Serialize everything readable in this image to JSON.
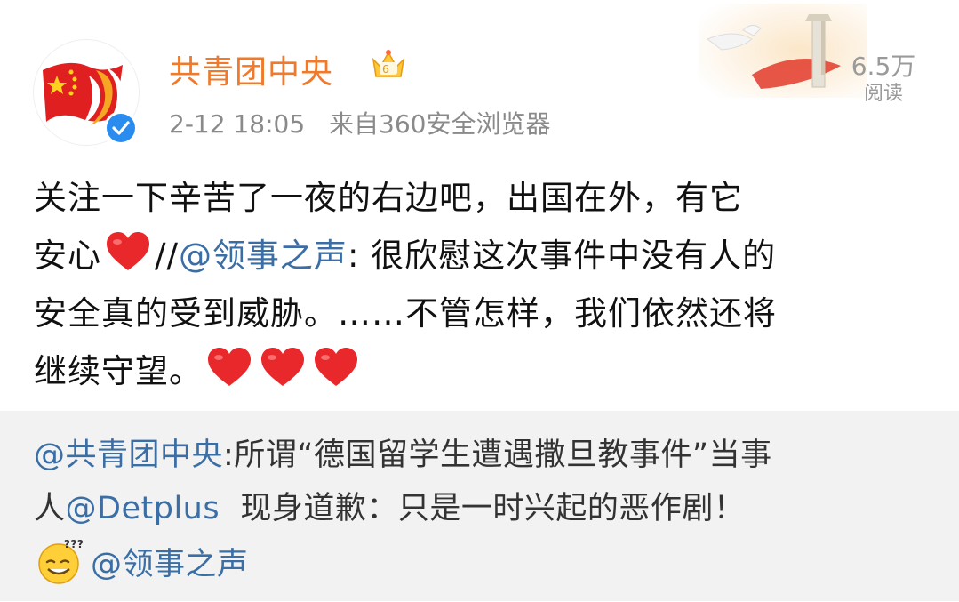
{
  "author": {
    "name": "共青团中央",
    "time": "2-12 18:05",
    "source": "来自360安全浏览器"
  },
  "stats": {
    "reads_count": "6.5万",
    "reads_label": "阅读"
  },
  "post": {
    "line1": "关注一下辛苦了一夜的右边吧，出国在外，有它",
    "line2_a": "安心",
    "line2_b": "//",
    "line2_mention": "@领事之声",
    "line2_c": ": 很欣慰这次事件中没有人的",
    "line3": "安全真的受到威胁。……不管怎样，我们依然还将",
    "line4": "继续守望。"
  },
  "repost": {
    "mention": "@共青团中央",
    "line1_rest": ":所谓“德国留学生遭遇撒旦教事件”当事",
    "line2_a": "人",
    "line2_mention": "@Detplus",
    "line2_rest": "  现身道歉：只是一时兴起的恶作剧！",
    "line3_mention": "@领事之声"
  },
  "colors": {
    "name": "#f07a2a",
    "mention": "#3a6ea5",
    "meta": "#8a8a8a",
    "repost_bg": "#f2f2f2",
    "heart": "#e8282b",
    "verified": "#2b8cf0"
  },
  "icons": [
    "crown-vip-icon",
    "verified-icon",
    "heart-icon",
    "doubt-emoji-icon"
  ]
}
